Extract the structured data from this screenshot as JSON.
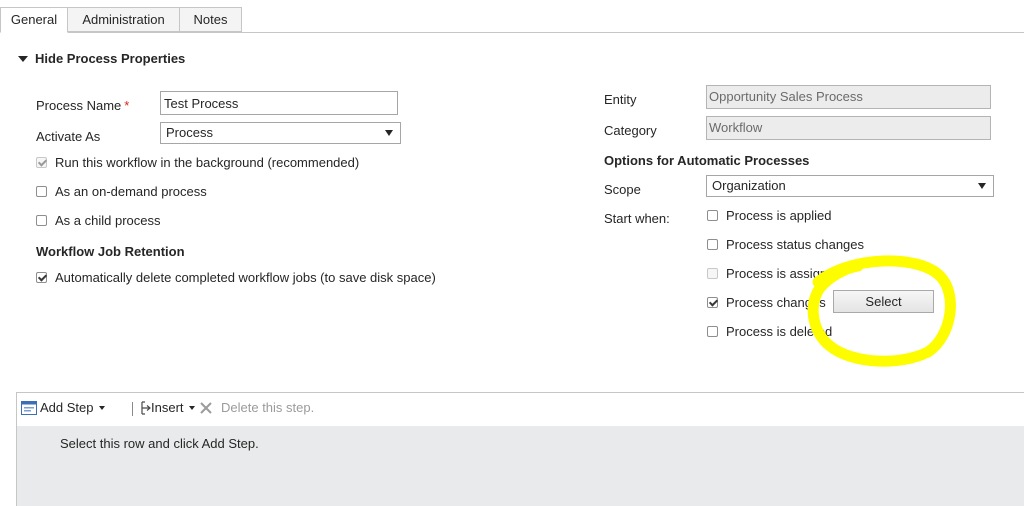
{
  "tabs": [
    {
      "label": "General"
    },
    {
      "label": "Administration"
    },
    {
      "label": "Notes"
    }
  ],
  "section": {
    "title": "Hide Process Properties"
  },
  "left": {
    "process_name_label": "Process Name",
    "required_mark": "*",
    "process_name_value": "Test Process",
    "activate_as_label": "Activate As",
    "activate_as_value": "Process",
    "options": [
      {
        "label": "Run this workflow in the background (recommended)",
        "checked": true,
        "disabled": true
      },
      {
        "label": "As an on-demand process",
        "checked": false,
        "disabled": false
      },
      {
        "label": "As a child process",
        "checked": false,
        "disabled": false
      }
    ],
    "retention_title": "Workflow Job Retention",
    "retention_option": {
      "label": "Automatically delete completed workflow jobs (to save disk space)",
      "checked": true
    }
  },
  "right": {
    "entity_label": "Entity",
    "entity_value": "Opportunity Sales Process",
    "category_label": "Category",
    "category_value": "Workflow",
    "auto_title": "Options for Automatic Processes",
    "scope_label": "Scope",
    "scope_value": "Organization",
    "start_when_label": "Start when:",
    "start_options": [
      {
        "label": "Process is applied",
        "checked": false,
        "disabled": false
      },
      {
        "label": "Process status changes",
        "checked": false,
        "disabled": false
      },
      {
        "label": "Process is assigned",
        "checked": false,
        "disabled": true
      },
      {
        "label": "Process changes",
        "checked": true,
        "disabled": false
      },
      {
        "label": "Process is deleted",
        "checked": false,
        "disabled": false
      }
    ],
    "select_button": "Select"
  },
  "toolbar": {
    "add_step": "Add Step",
    "insert": "Insert",
    "delete": "Delete this step."
  },
  "steps": {
    "hint": "Select this row and click Add Step."
  },
  "colors": {
    "highlight": "#fdfd00"
  }
}
